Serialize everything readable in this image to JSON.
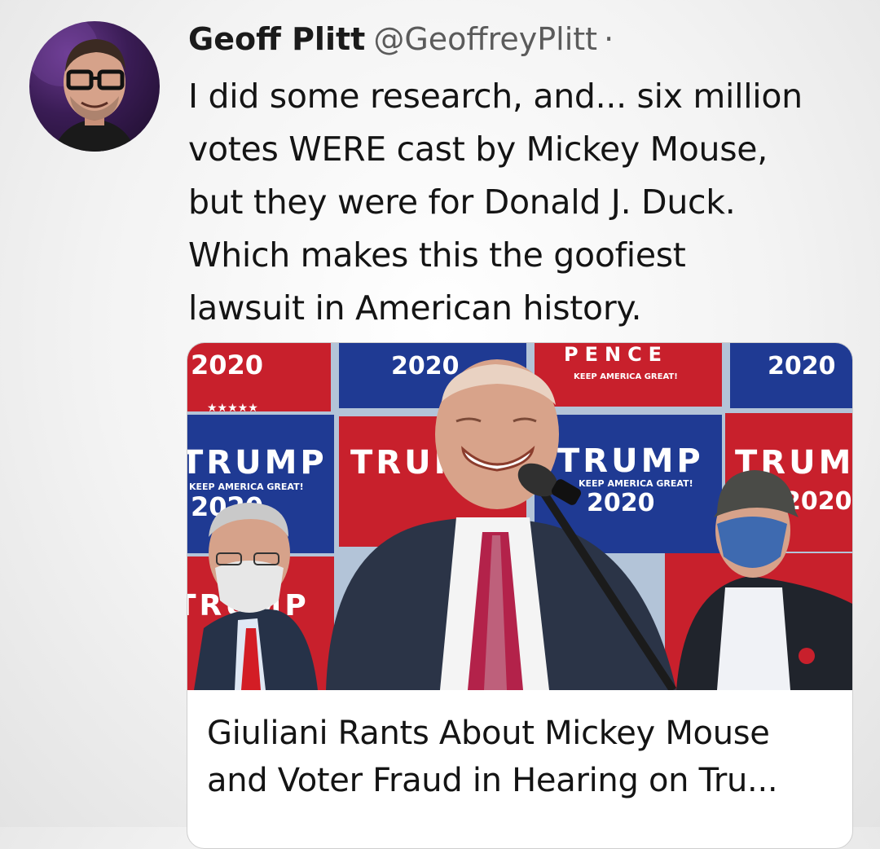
{
  "tweet": {
    "display_name": "Geoff Plitt",
    "handle": "@GeoffreyPlitt",
    "separator": "·",
    "text_lines": [
      "I did some research, and... six million",
      "votes WERE cast by Mickey Mouse,",
      "but they were for Donald J. Duck.",
      "Which makes this the goofiest",
      "lawsuit in American history."
    ]
  },
  "card": {
    "title_lines": [
      "Giuliani Rants About Mickey Mouse",
      "and Voter Fraud in Hearing on Tru..."
    ],
    "signs": {
      "year": "2020",
      "trump": "TRUMP",
      "pence": "PENCE",
      "slogan": "KEEP AMERICA GREAT!",
      "stars": "★★★★★"
    }
  },
  "colors": {
    "sign_red": "#c8202c",
    "sign_blue": "#1f3a93",
    "suit": "#2b3447",
    "tie": "#b3224a"
  }
}
